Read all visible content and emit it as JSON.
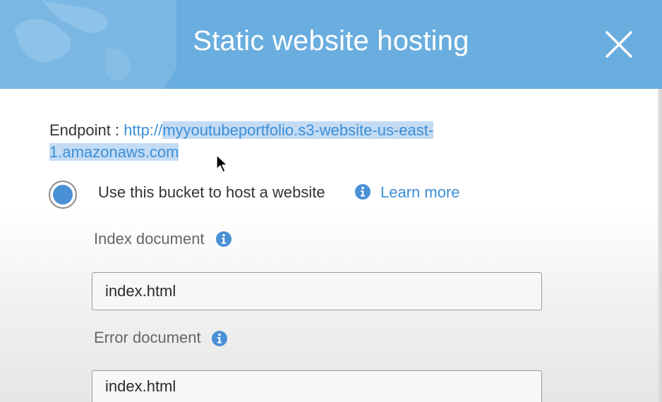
{
  "modal": {
    "title": "Static website hosting"
  },
  "endpoint": {
    "label": "Endpoint : ",
    "url_prefix": "http://",
    "url_selected_line1": "myyoutubeportfolio.s3-website-us-east-",
    "url_selected_line2": "1.amazonaws.com"
  },
  "hosting_option": {
    "label": "Use this bucket to host a website",
    "learn_more": "Learn more",
    "selected": true
  },
  "index_document": {
    "label": "Index document",
    "value": "index.html"
  },
  "error_document": {
    "label": "Error document",
    "value": "index.html"
  },
  "colors": {
    "header": "#6aaedf",
    "link": "#3b8fd6",
    "radio_fill": "#4a90d6",
    "selection": "#c4dbf4"
  },
  "icons": [
    "globe-icon",
    "close-icon",
    "info-icon",
    "mouse-cursor-icon"
  ]
}
